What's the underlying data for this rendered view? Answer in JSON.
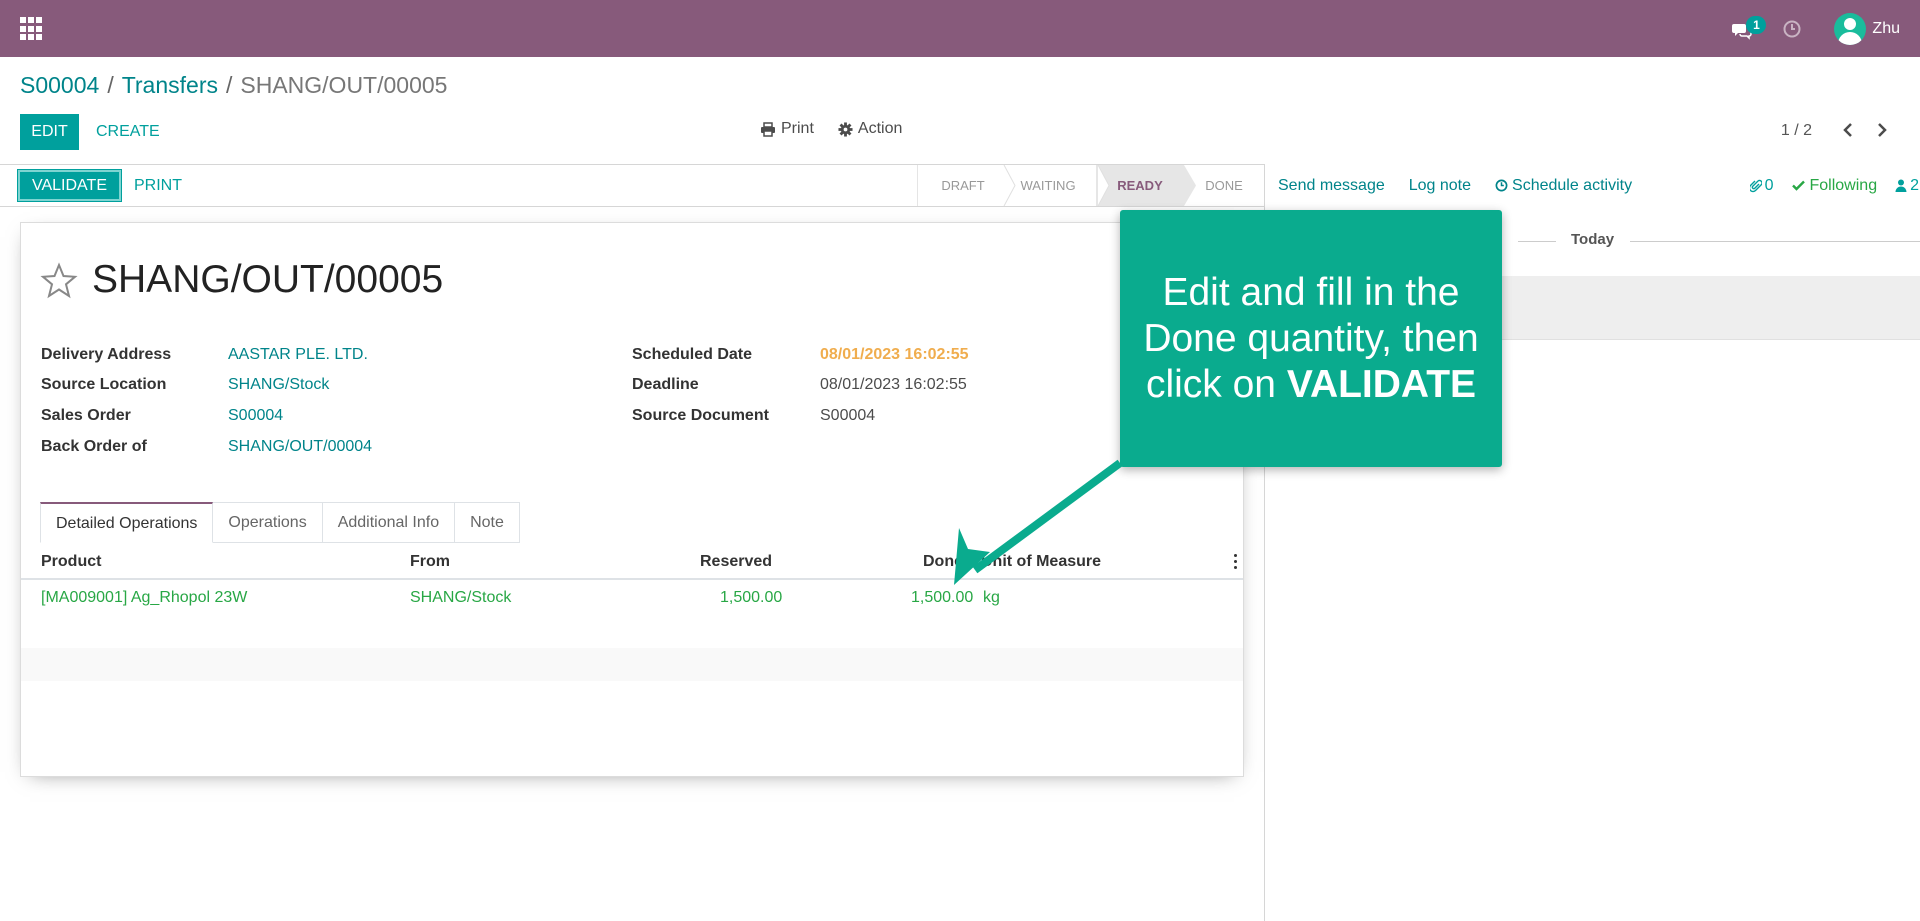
{
  "navbar": {
    "chat_badge": "1",
    "user_name": "Zhu"
  },
  "breadcrumb": {
    "items": [
      "S00004",
      "Transfers"
    ],
    "separator": "/",
    "current": "SHANG/OUT/00005"
  },
  "toolbar": {
    "edit_label": "EDIT",
    "create_label": "CREATE",
    "print_label": "Print",
    "action_label": "Action",
    "pager": "1 / 2"
  },
  "statusbar": {
    "validate_label": "VALIDATE",
    "print_label": "PRINT",
    "stages": [
      "DRAFT",
      "WAITING",
      "READY",
      "DONE"
    ],
    "active_stage": "READY"
  },
  "chatter": {
    "send_message": "Send message",
    "log_note": "Log note",
    "schedule_activity": "Schedule activity",
    "attachments": "0",
    "following": "Following",
    "followers": "2",
    "today": "Today"
  },
  "record": {
    "title": "SHANG/OUT/00005",
    "left_fields": [
      {
        "label": "Delivery Address",
        "value": "AASTAR PLE. LTD."
      },
      {
        "label": "Source Location",
        "value": "SHANG/Stock"
      },
      {
        "label": "Sales Order",
        "value": "S00004"
      },
      {
        "label": "Back Order of",
        "value": "SHANG/OUT/00004"
      }
    ],
    "right_fields": [
      {
        "label": "Scheduled Date",
        "value": "08/01/2023 16:02:55"
      },
      {
        "label": "Deadline",
        "value": "08/01/2023 16:02:55"
      },
      {
        "label": "Source Document",
        "value": "S00004"
      }
    ]
  },
  "tabs": [
    "Detailed Operations",
    "Operations",
    "Additional Info",
    "Note"
  ],
  "table": {
    "columns": [
      "Product",
      "From",
      "Reserved",
      "Done",
      "Unit of Measure"
    ],
    "rows": [
      {
        "product": "[MA009001] Ag_Rhopol 23W",
        "from": "SHANG/Stock",
        "reserved": "1,500.00",
        "done": "1,500.00",
        "uom": "kg"
      }
    ]
  },
  "callout": {
    "line1": "Edit and fill in the",
    "line2": "Done quantity, then",
    "line3_prefix": "click on ",
    "line3_bold": "VALIDATE"
  },
  "colors": {
    "navbar": "#875a7b",
    "primary": "#00a09d",
    "link": "#00848a",
    "callout": "#0aab8e",
    "warning": "#f0ad4e",
    "success": "#28a745"
  }
}
